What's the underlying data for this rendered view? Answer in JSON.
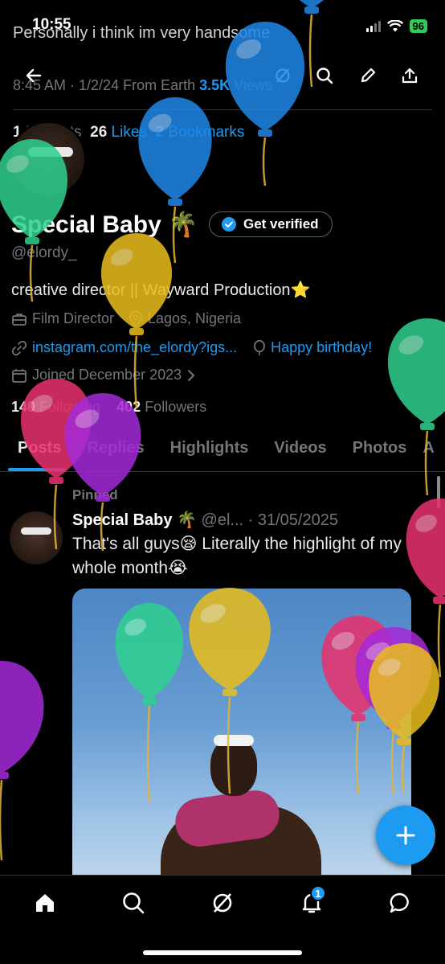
{
  "status_bar": {
    "time": "10:55",
    "battery": "96"
  },
  "background_tweet": {
    "text": "Personally i think im very handsome",
    "meta": "8:45 AM · 1/2/24 From Earth",
    "views_count": "3.5K",
    "views_label": "Views",
    "reposts_count": "1",
    "reposts_label": "Reposts",
    "likes_count": "26",
    "likes_label": "Likes",
    "bookmarks_count": "2",
    "bookmarks_label": "Bookmarks"
  },
  "topbar": {
    "icons": [
      "back-arrow-icon",
      "grok-icon",
      "search-icon",
      "edit-icon",
      "share-icon"
    ]
  },
  "profile": {
    "name": "Special Baby",
    "name_emoji": "🌴",
    "verify_label": "Get verified",
    "handle": "@elordy_",
    "bio": "creative director || Wayward Production⭐",
    "profession": "Film Director",
    "location": "Lagos, Nigeria",
    "website": "instagram.com/the_elordy?igs...",
    "birthday": "Happy birthday!",
    "joined": "Joined December 2023",
    "following_count": "140",
    "following_label": "Following",
    "followers_count": "402",
    "followers_label": "Followers"
  },
  "tabs": [
    {
      "label": "Posts",
      "active": true
    },
    {
      "label": "Replies",
      "active": false
    },
    {
      "label": "Highlights",
      "active": false
    },
    {
      "label": "Videos",
      "active": false
    },
    {
      "label": "Photos",
      "active": false
    },
    {
      "label": "A",
      "active": false
    }
  ],
  "pinned_post": {
    "pinned_label": "Pinned",
    "author_name": "Special Baby",
    "author_emoji": "🌴",
    "author_handle": "@el...",
    "date": "· 31/05/2025",
    "text": "That's all guys😪 Literally the highlight of my whole month😭"
  },
  "bottom_nav": {
    "items": [
      "home-icon",
      "search-icon",
      "grok-icon",
      "notifications-icon",
      "messages-icon"
    ],
    "notifications_badge": "1"
  },
  "colors": {
    "accent": "#1d9bf0",
    "balloons": [
      "#2fd08f",
      "#1f86e6",
      "#e9bd1d",
      "#e8316c",
      "#a52ad8"
    ]
  }
}
